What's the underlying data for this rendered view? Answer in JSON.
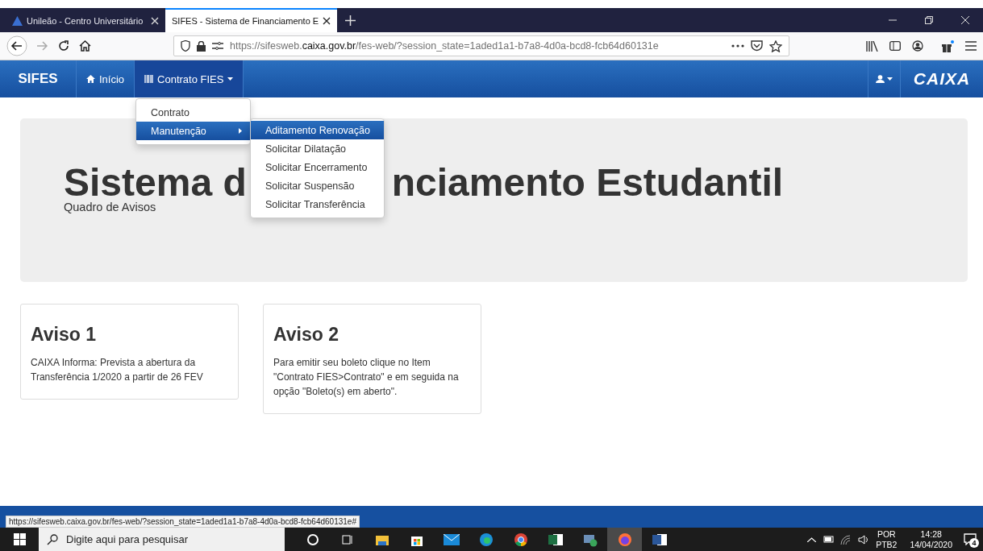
{
  "browser": {
    "tabs": [
      {
        "title": "Unileão - Centro Universitário",
        "selected": false
      },
      {
        "title": "SIFES - Sistema de Financiamento E",
        "selected": true
      }
    ],
    "url": {
      "prefix": "https://sifesweb.",
      "domain": "caixa.gov.br",
      "suffix": "/fes-web/?session_state=1aded1a1-b7a8-4d0a-bcd8-fcb64d60131e"
    }
  },
  "navbar": {
    "brand": "SIFES",
    "items": [
      {
        "label": "Início",
        "kind": "home",
        "selected": false
      },
      {
        "label": "Contrato FIES",
        "kind": "contract",
        "selected": true
      }
    ],
    "logo": "CAIXA"
  },
  "dropdown": {
    "items": [
      {
        "label": "Contrato",
        "selected": false,
        "submenu": false
      },
      {
        "label": "Manutenção",
        "selected": true,
        "submenu": true
      }
    ],
    "submenu": [
      {
        "label": "Aditamento Renovação",
        "selected": true
      },
      {
        "label": "Solicitar Dilatação",
        "selected": false
      },
      {
        "label": "Solicitar Encerramento",
        "selected": false
      },
      {
        "label": "Solicitar Suspensão",
        "selected": false
      },
      {
        "label": "Solicitar Transferência",
        "selected": false
      }
    ]
  },
  "jumbotron": {
    "heading_visible_start": "Sistema d",
    "heading_visible_end": "nciamento Estudantil",
    "subtitle": "Quadro de Avisos"
  },
  "cards": [
    {
      "title": "Aviso 1",
      "text": "CAIXA Informa: Prevista a abertura da Transferência 1/2020 a partir de 26 FEV"
    },
    {
      "title": "Aviso 2",
      "text": "Para emitir seu boleto clique no Item \"Contrato FIES>Contrato\" e em seguida na opção \"Boleto(s) em aberto\"."
    }
  ],
  "status_url": "https://sifesweb.caixa.gov.br/fes-web/?session_state=1aded1a1-b7a8-4d0a-bcd8-fcb64d60131e#",
  "taskbar": {
    "search_placeholder": "Digite aqui para pesquisar",
    "apps": [
      {
        "kind": "cortana",
        "selected": false
      },
      {
        "kind": "taskview",
        "selected": false
      },
      {
        "kind": "folder",
        "selected": false
      },
      {
        "kind": "store",
        "selected": false
      },
      {
        "kind": "mail",
        "selected": false
      },
      {
        "kind": "edge",
        "selected": false
      },
      {
        "kind": "chrome",
        "selected": false
      },
      {
        "kind": "excel",
        "selected": false
      },
      {
        "kind": "remote",
        "selected": false
      },
      {
        "kind": "firefox",
        "selected": true
      },
      {
        "kind": "word",
        "selected": false
      }
    ],
    "language": "POR",
    "layout": "PTB2",
    "time": "14:28",
    "date": "14/04/2020",
    "notifications": "4"
  }
}
